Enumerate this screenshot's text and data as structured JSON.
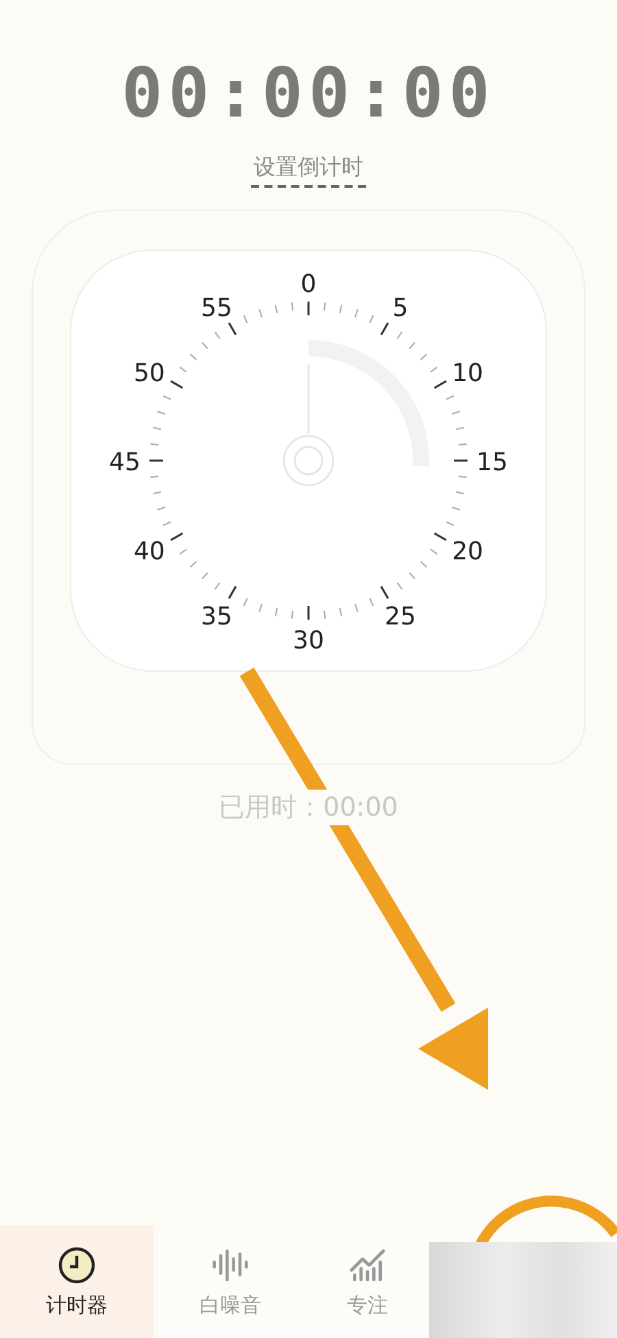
{
  "display": {
    "time": "00:00:00"
  },
  "set_countdown": {
    "label": "设置倒计时"
  },
  "dial": {
    "labels": [
      "0",
      "5",
      "10",
      "15",
      "20",
      "25",
      "30",
      "35",
      "40",
      "45",
      "50",
      "55"
    ]
  },
  "elapsed": {
    "text": "已用时：00:00"
  },
  "tabs": [
    {
      "label": "计时器",
      "selected": true,
      "kind": "clock"
    },
    {
      "label": "白噪音",
      "selected": false,
      "kind": "sound"
    },
    {
      "label": "专注",
      "selected": false,
      "kind": "chart"
    }
  ]
}
